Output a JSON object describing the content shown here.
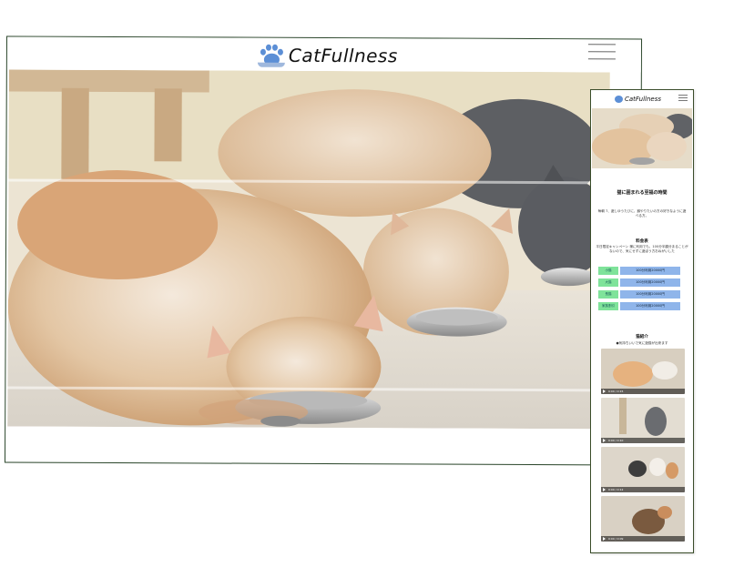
{
  "brand": {
    "name": "CatFullness"
  },
  "icons": {
    "logo": "paw-dish-icon",
    "menu": "hamburger-menu-icon",
    "play": "play-icon"
  },
  "colors": {
    "paw_blue": "#5c8fd6",
    "price_label_green": "#7fe39a",
    "price_value_blue": "#8fb5ea"
  },
  "mobile": {
    "title": "猫に囲まれる至福の時間",
    "intro": "毎朝 7、遊しゆうたびに、餌やりたいの方の好きなように遊べる方。",
    "pricing": {
      "heading": "料金表",
      "note": "平日限定キャンペーン 様に利用でも、100分半額分まることがないので、気にせずに遊ぼう方おねがいした",
      "rows": [
        {
          "label": "小猫",
          "value": "100分利用20000円"
        },
        {
          "label": "大猫",
          "value": "100分利用20000円"
        },
        {
          "label": "長猫",
          "value": "100分利用20000円"
        },
        {
          "label": "家族割引",
          "value": "100分利用20000円"
        }
      ]
    },
    "videos": {
      "heading": "猫紹介",
      "note": "●気持ちいいで気に遊猫が出来ます",
      "items": [
        {
          "time": "0:00 / 0:15"
        },
        {
          "time": "0:00 / 0:10"
        },
        {
          "time": "0:00 / 0:12"
        },
        {
          "time": "0:00 / 0:09"
        }
      ]
    }
  }
}
